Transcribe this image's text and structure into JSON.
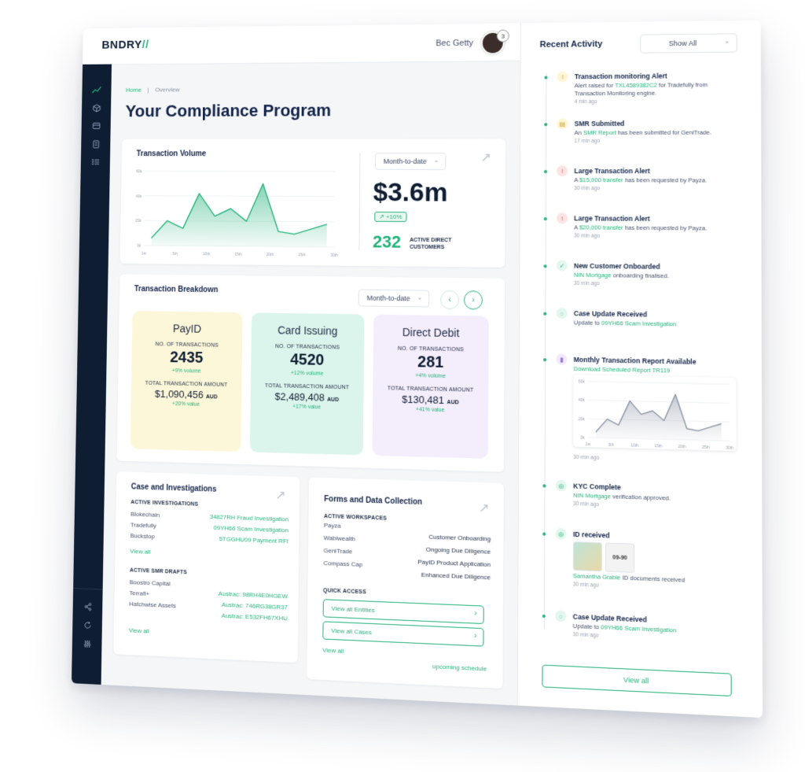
{
  "header": {
    "logo": "BNDRY",
    "logo_mark": "//",
    "user_name": "Bec Getty",
    "notification_count": "3"
  },
  "breadcrumb": {
    "home": "Home",
    "sep": "|",
    "current": "Overview"
  },
  "page_title": "Your Compliance Program",
  "volume": {
    "title": "Transaction Volume",
    "period": "Month-to-date",
    "amount": "$3.6m",
    "change": "+10%",
    "customers_count": "232",
    "customers_label_1": "ACTIVE DIRECT",
    "customers_label_2": "CUSTOMERS",
    "chart_y_ticks": [
      "60k",
      "40k",
      "20k",
      "0k"
    ],
    "chart_x_ticks": [
      "1st",
      "5th",
      "10th",
      "15th",
      "20th",
      "25th",
      "30th"
    ],
    "chart_values": [
      6,
      20,
      14,
      42,
      24,
      30,
      20,
      50,
      12,
      10,
      14,
      18
    ]
  },
  "breakdown": {
    "title": "Transaction Breakdown",
    "period": "Month-to-date",
    "tiles": [
      {
        "name": "PayID",
        "count_label": "NO. OF TRANSACTIONS",
        "count": "2435",
        "count_delta": "+9% volume",
        "amount_label": "TOTAL TRANSACTION AMOUNT",
        "amount": "$1,090,456",
        "currency": "AUD",
        "amount_delta": "+20% value",
        "color": "#fdf7d9"
      },
      {
        "name": "Card Issuing",
        "count_label": "NO. OF TRANSACTIONS",
        "count": "4520",
        "count_delta": "+12% volume",
        "amount_label": "TOTAL TRANSACTION AMOUNT",
        "amount": "$2,489,408",
        "currency": "AUD",
        "amount_delta": "+17% value",
        "color": "#dcf5ec"
      },
      {
        "name": "Direct Debit",
        "count_label": "NO. OF TRANSACTIONS",
        "count": "281",
        "count_delta": "+4% volume",
        "amount_label": "TOTAL TRANSACTION AMOUNT",
        "amount": "$130,481",
        "currency": "AUD",
        "amount_delta": "+41% value",
        "color": "#f4edfb"
      }
    ]
  },
  "cases": {
    "title": "Case and Investigations",
    "active_label": "ACTIVE INVESTIGATIONS",
    "active": [
      {
        "entity": "Blokechain",
        "case": "34827RH Fraud Investigation"
      },
      {
        "entity": "Tradefully",
        "case": "09YH66 Scam Investigation"
      },
      {
        "entity": "Buckstop",
        "case": "5TGGHU09 Payment RFI"
      }
    ],
    "view_all_1": "View all",
    "drafts_label": "ACTIVE SMR DRAFTS",
    "drafts": [
      {
        "entity": "Boostro Capital",
        "ref": "Austrac: 98RH4E0HGEW"
      },
      {
        "entity": "Terrafi+",
        "ref": "Austrac: 746RG38GR37"
      },
      {
        "entity": "Hatchwise Assets",
        "ref": "Austrac: E532FH67XHU"
      }
    ],
    "view_all_2": "View all"
  },
  "forms": {
    "title": "Forms and Data Collection",
    "workspaces_label": "ACTIVE WORKSPACES",
    "workspaces": [
      {
        "entity": "Payza",
        "stage": "Customer Onboarding"
      },
      {
        "entity": "Wabiwealth",
        "stage": "Ongoing Due Diligence"
      },
      {
        "entity": "GeniTrade",
        "stage": "PayID Product Application"
      },
      {
        "entity": "Compass Cap",
        "stage": "Enhanced Due Diligence"
      }
    ],
    "quick_label": "QUICK ACCESS",
    "quick_1": "View all Entities",
    "quick_2": "View all Cases",
    "view_all": "View all",
    "schedule": "upcoming schedule"
  },
  "activity": {
    "title": "Recent Activity",
    "filter": "Show All",
    "items": [
      {
        "head": "Transaction monitoring Alert",
        "pre": "Alert raised for ",
        "link": "TXL4589382C2",
        "post": " for Tradefully from Transaction Monitoring engine.",
        "time": "4 min ago"
      },
      {
        "head": "SMR Submitted",
        "pre": "An ",
        "link": "SMR Report",
        "post": " has been submitted for GeniTrade.",
        "time": "17 min ago"
      },
      {
        "head": "Large Transaction Alert",
        "pre": "A ",
        "link": "$15,000 transfer",
        "post": " has been requested by Payza.",
        "time": "30 min ago"
      },
      {
        "head": "Large Transaction Alert",
        "pre": "A ",
        "link": "$20,000 transfer",
        "post": " has been requested by Payza.",
        "time": "30 min ago"
      },
      {
        "head": "New Customer Onboarded",
        "pre": "",
        "link": "NIN Mortgage",
        "post": " onboarding finalised.",
        "time": "30 min ago"
      },
      {
        "head": "Case Update Received",
        "pre": "Update to ",
        "link": "09YH66 Scam Investigation",
        "post": "",
        "time": ""
      },
      {
        "head": "Monthly Transaction Report Available",
        "pre": "",
        "link": "Download Scheduled Report TR119",
        "post": "",
        "time": "30 min ago"
      },
      {
        "head": "KYC Complete",
        "pre": "",
        "link": "NIN Mortgage",
        "post": " verification approved.",
        "time": "30 min ago"
      },
      {
        "head": "ID received",
        "pre": "",
        "link": "Samantha Grable",
        "post": " ID documents received",
        "time": "30 min ago"
      },
      {
        "head": "Case Update Received",
        "pre": "Update to ",
        "link": "09YH66 Scam Investigation",
        "post": "",
        "time": "30 min ago"
      }
    ],
    "mini_chart_y_ticks": [
      "60k",
      "40k",
      "20k",
      "0k"
    ],
    "mini_chart_x_ticks": [
      "1st",
      "5th",
      "10th",
      "15th",
      "20th",
      "25th",
      "30th"
    ],
    "mini_chart_values": [
      6,
      20,
      14,
      40,
      26,
      30,
      20,
      48,
      12,
      10,
      14,
      18
    ],
    "id_thumb_text": "09-90",
    "view_all": "View all"
  },
  "colors": {
    "accent": "#23b27a",
    "navy": "#0f1d33",
    "alert": "#e5484d",
    "warn": "#f2c94c",
    "purple": "#9b6bd6"
  }
}
